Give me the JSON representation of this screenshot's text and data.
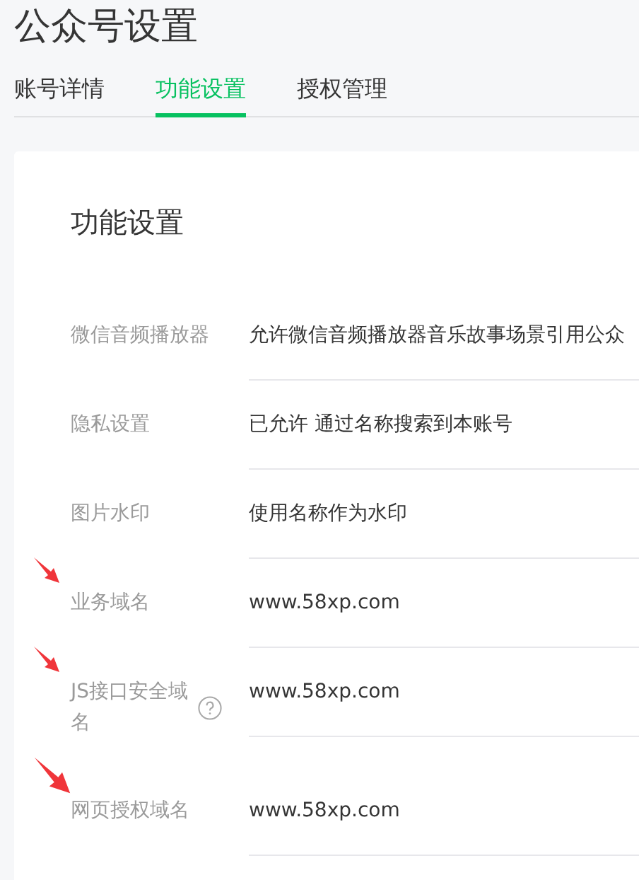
{
  "page_title": "公众号设置",
  "tabs": [
    {
      "label": "账号详情",
      "selected": false
    },
    {
      "label": "功能设置",
      "selected": true
    },
    {
      "label": "授权管理",
      "selected": false
    }
  ],
  "card": {
    "title": "功能设置",
    "rows": [
      {
        "label": "微信音频播放器",
        "value": "允许微信音频播放器音乐故事场景引用公众",
        "help": false,
        "annotated": false
      },
      {
        "label": "隐私设置",
        "value": "已允许 通过名称搜索到本账号",
        "help": false,
        "annotated": false
      },
      {
        "label": "图片水印",
        "value": "使用名称作为水印",
        "help": false,
        "annotated": false
      },
      {
        "label": "业务域名",
        "value": "www.58xp.com",
        "help": false,
        "annotated": true
      },
      {
        "label": "JS接口安全域名",
        "value": "www.58xp.com",
        "help": true,
        "annotated": true
      },
      {
        "label": "网页授权域名",
        "value": "www.58xp.com",
        "help": false,
        "annotated": true
      }
    ]
  }
}
